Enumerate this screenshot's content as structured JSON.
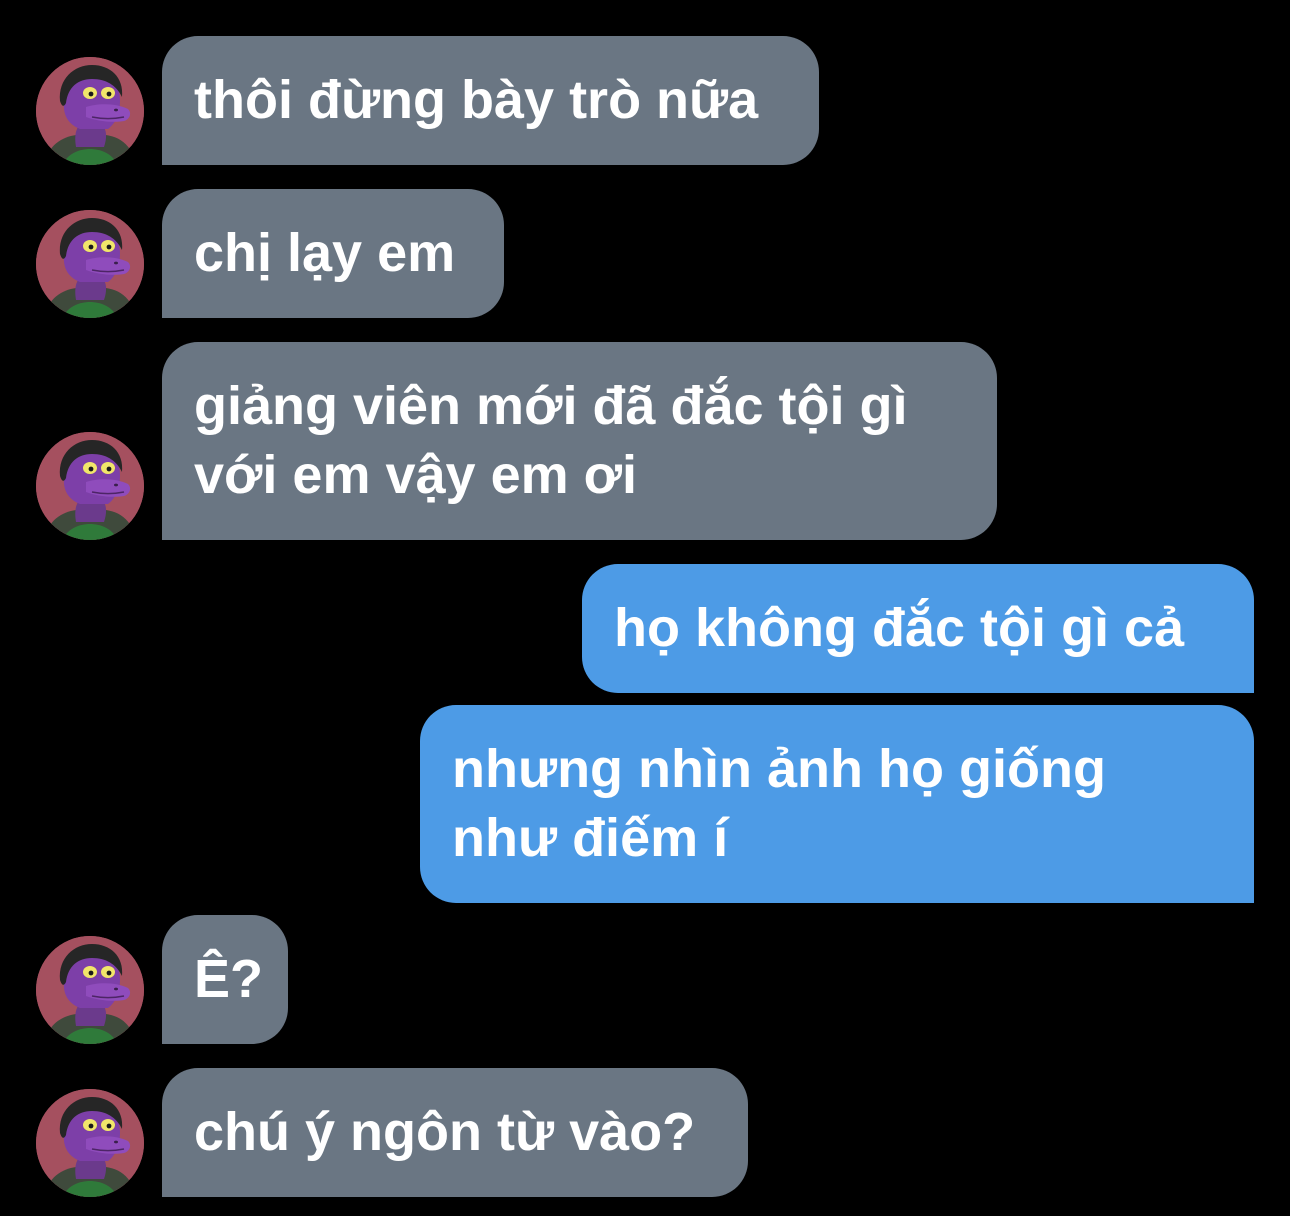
{
  "conversation": {
    "colors": {
      "background": "#000000",
      "incoming_bubble": "#6a7683",
      "outgoing_bubble": "#4d9be6",
      "text": "#ffffff",
      "avatar_background": "#a5505f"
    },
    "avatar_icon": "purple-cartoon-character-avatar",
    "messages": [
      {
        "sender": "them",
        "text": "thôi đừng bày trò nữa"
      },
      {
        "sender": "them",
        "text": "chị lạy em"
      },
      {
        "sender": "them",
        "text": "giảng viên mới đã đắc tội gì\nvới em vậy em ơi"
      },
      {
        "sender": "me",
        "text": "họ không đắc tội gì cả"
      },
      {
        "sender": "me",
        "text": "nhưng nhìn ảnh họ giống\nnhư điếm í"
      },
      {
        "sender": "them",
        "text": "Ê?"
      },
      {
        "sender": "them",
        "text": "chú ý ngôn từ vào?"
      }
    ]
  }
}
